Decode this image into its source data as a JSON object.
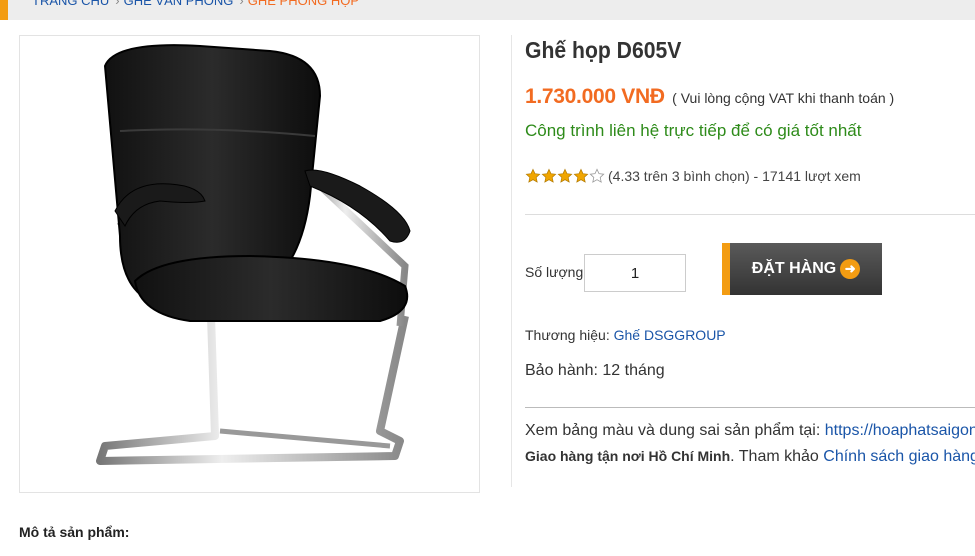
{
  "breadcrumb": {
    "items": [
      "TRANG CHỦ",
      "GHẾ VĂN PHÒNG",
      "GHẾ PHÒNG HỌP"
    ]
  },
  "product": {
    "title": "Ghế họp D605V",
    "price": "1.730.000 VNĐ",
    "vat_note": "( Vui lòng cộng VAT khi thanh toán )",
    "contact_note": "Công trình liên hệ trực tiếp để có giá tốt nhất",
    "rating": {
      "score_text": "(4.33 trên 3 bình chọn) - 17141 lượt xem",
      "stars_filled": 4,
      "stars_total": 5
    },
    "quantity_label": "Số lượng",
    "quantity_value": "1",
    "order_button": "ĐẶT HÀNG",
    "brand_label": "Thương hiệu:",
    "brand_value": "Ghế DSGGROUP",
    "warranty": "Bảo hành: 12 tháng",
    "color_info_text": "Xem bảng màu và dung sai sản phẩm tại:",
    "color_info_link": "https://hoaphatsaigon.com",
    "delivery_bold": "Giao hàng tận nơi Hồ Chí Minh",
    "delivery_text": ". Tham khảo",
    "delivery_link": "Chính sách giao hàng"
  },
  "description": {
    "title": "Mô tả sản phẩm:"
  },
  "colors": {
    "accent": "#f26b21",
    "link": "#1a55a8",
    "contact_green": "#2e8b1a",
    "star": "#f0a500"
  }
}
